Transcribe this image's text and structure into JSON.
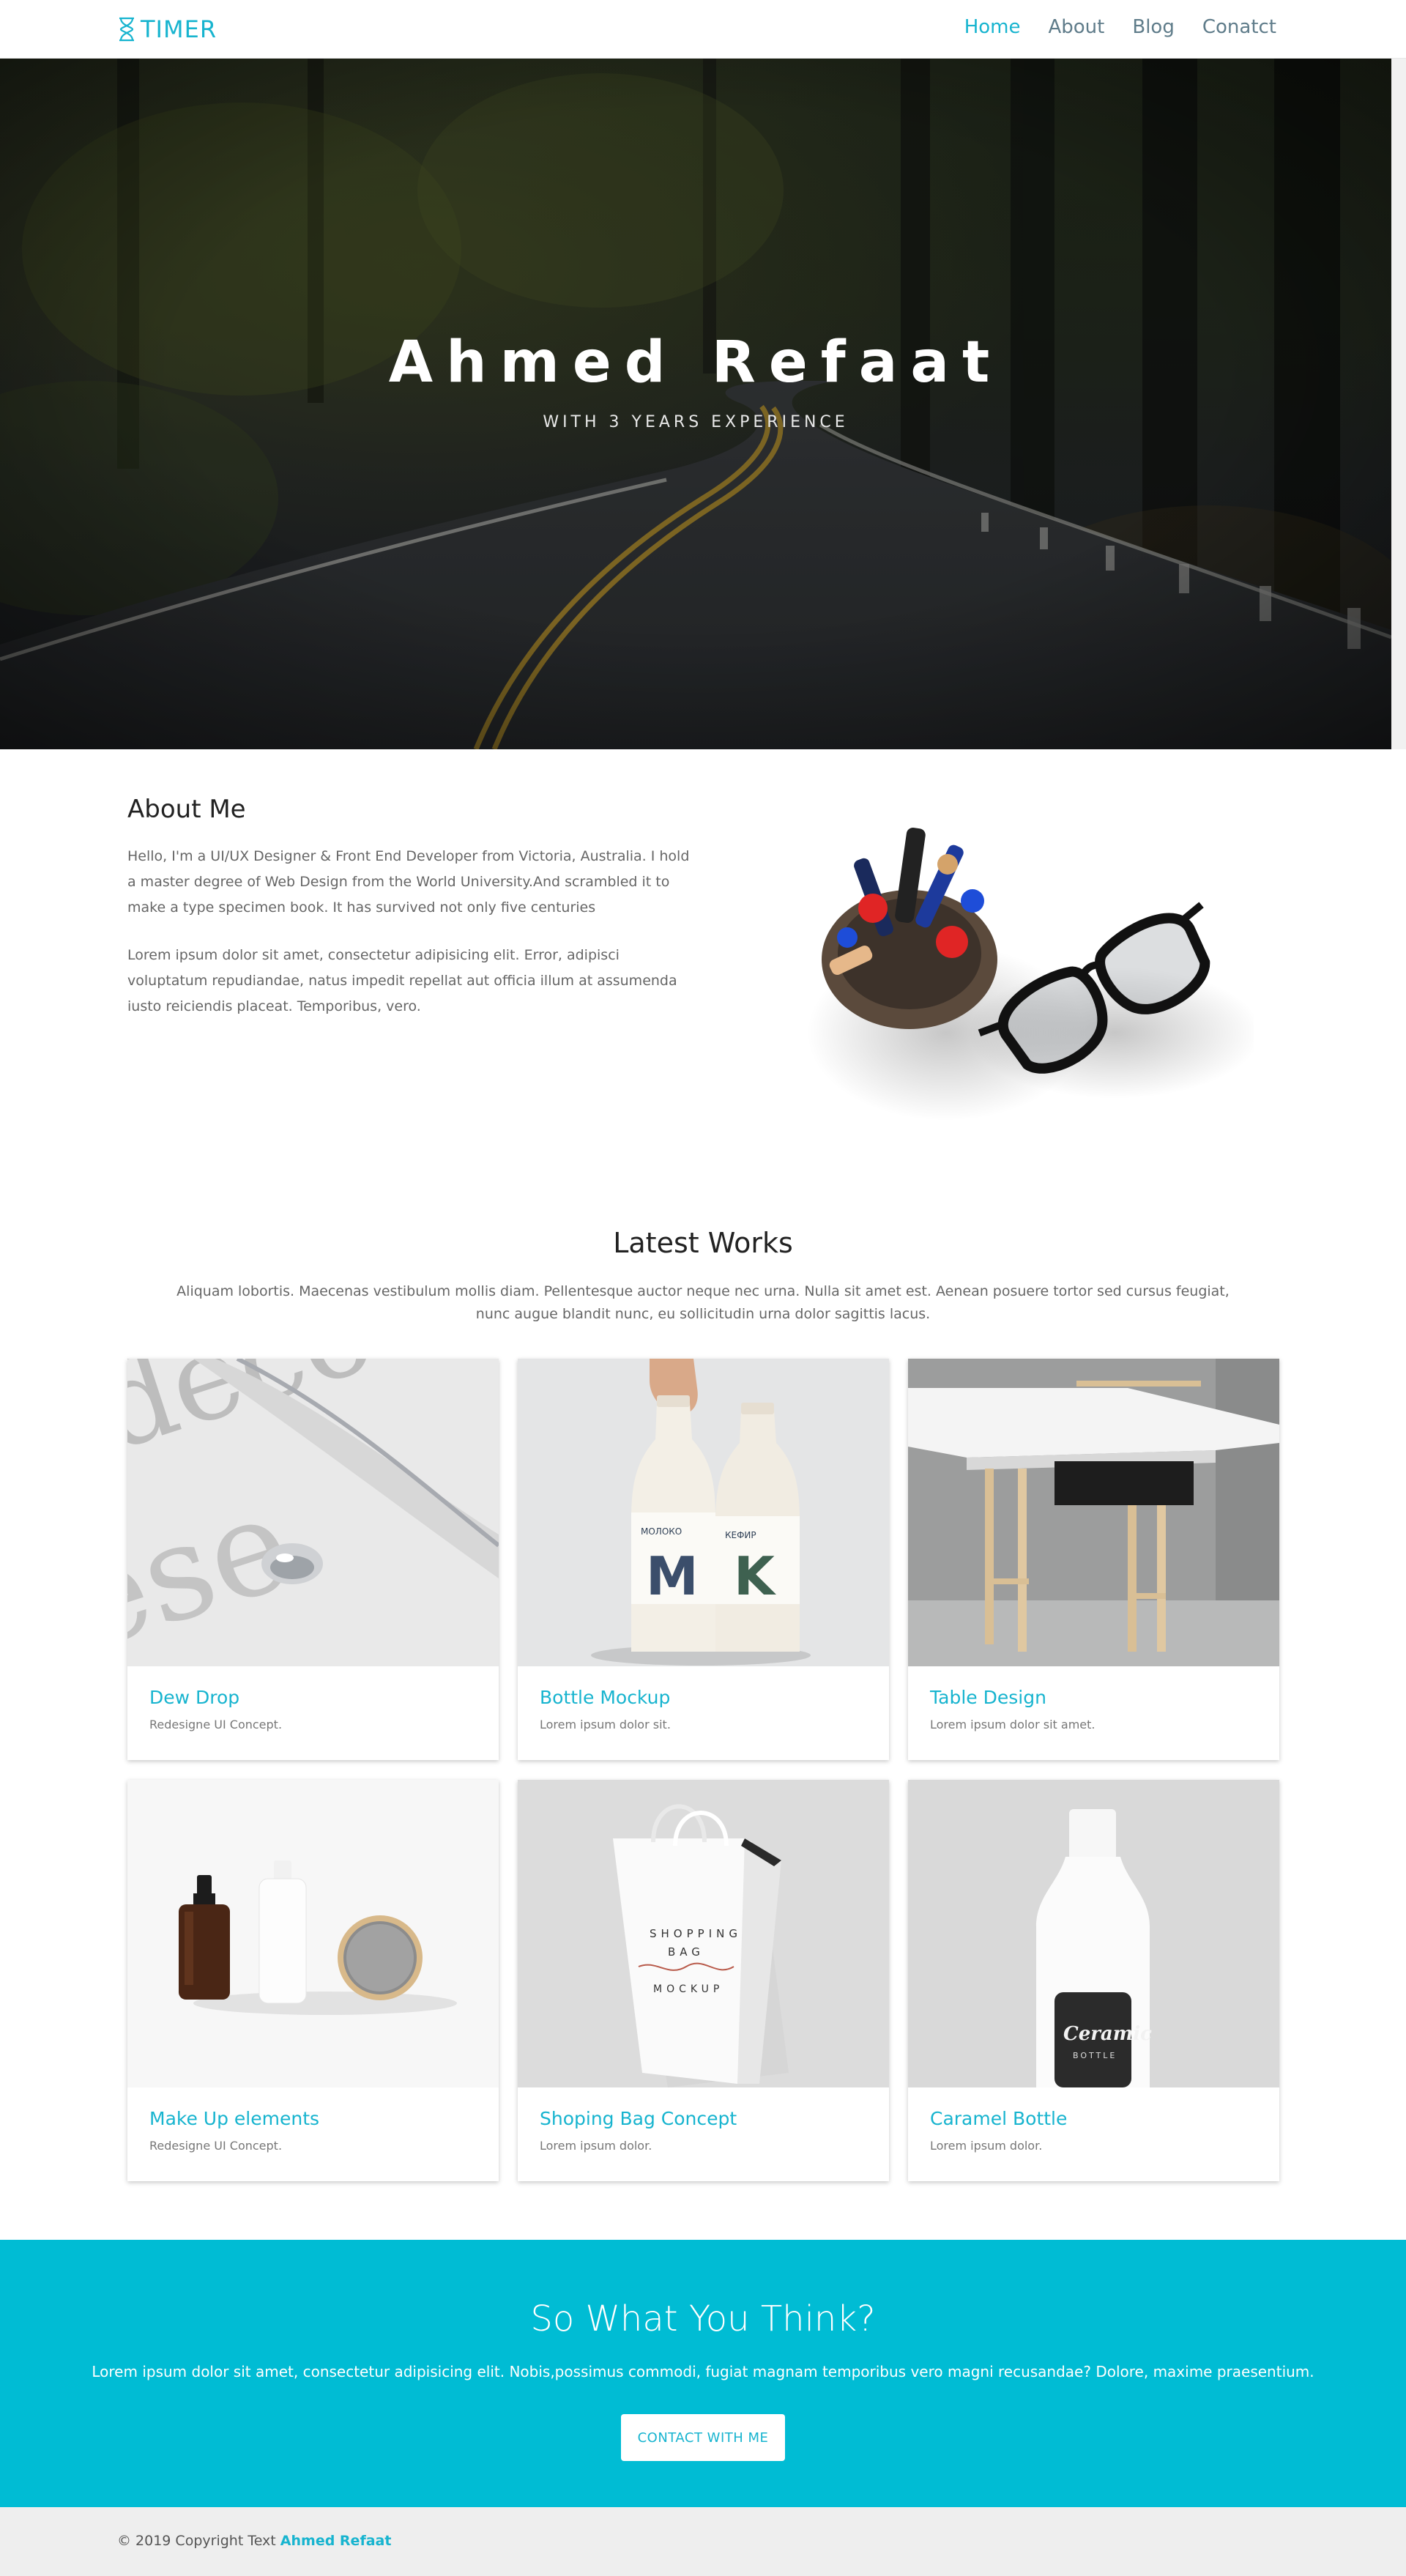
{
  "nav": {
    "logo": "TIMER",
    "items": [
      {
        "label": "Home",
        "active": true
      },
      {
        "label": "About",
        "active": false
      },
      {
        "label": "Blog",
        "active": false
      },
      {
        "label": "Conatct",
        "active": false
      }
    ]
  },
  "hero": {
    "title": "Ahmed Refaat",
    "subtitle": "WITH  3  YEARS  EXPERIENCE"
  },
  "about": {
    "title": "About Me",
    "p1": "Hello, I'm a UI/UX Designer & Front End Developer from Victoria, Australia. I hold a master degree of Web Design from the World University.And scrambled it to make a type specimen book. It has survived not only five centuries",
    "p2": "Lorem ipsum dolor sit amet, consectetur adipisicing elit. Error, adipisci voluptatum repudiandae, natus impedit repellat aut officia illum at assumenda iusto reiciendis placeat. Temporibus, vero."
  },
  "works": {
    "title": "Latest Works",
    "description": "Aliquam lobortis. Maecenas vestibulum mollis diam. Pellentesque auctor neque nec urna. Nulla sit amet est. Aenean posuere tortor sed cursus feugiat, nunc augue blandit nunc, eu sollicitudin urna dolor sagittis lacus.",
    "items": [
      {
        "title": "Dew Drop",
        "desc": "Redesigne UI Concept."
      },
      {
        "title": "Bottle Mockup",
        "desc": "Lorem ipsum dolor sit."
      },
      {
        "title": "Table Design",
        "desc": "Lorem ipsum dolor sit amet."
      },
      {
        "title": "Make Up elements",
        "desc": "Redesigne UI Concept."
      },
      {
        "title": "Shoping Bag Concept",
        "desc": "Lorem ipsum dolor."
      },
      {
        "title": "Caramel Bottle",
        "desc": "Lorem ipsum dolor."
      }
    ],
    "image_text": {
      "milk_left": "МОЛОКО",
      "milk_right": "КЕФИР",
      "milk_letters": "M K",
      "bag_top": "SHOPPING",
      "bag_bottom": "BAG",
      "bag_line": "MOCKUP",
      "bottle_label": "Ceramic",
      "bottle_sub": "BOTTLE"
    }
  },
  "cta": {
    "title": "So What You Think?",
    "text": "Lorem ipsum dolor sit amet, consectetur adipisicing elit. Nobis,possimus commodi, fugiat magnam temporibus vero magni recusandae? Dolore, maxime praesentium.",
    "button": "CONTACT WITH ME"
  },
  "footer": {
    "text": "© 2019 Copyright Text",
    "name": "Ahmed Refaat"
  },
  "colors": {
    "accent": "#17b4cf",
    "cta_bg": "#00bcd4",
    "footer_bg": "#eeeeee"
  }
}
